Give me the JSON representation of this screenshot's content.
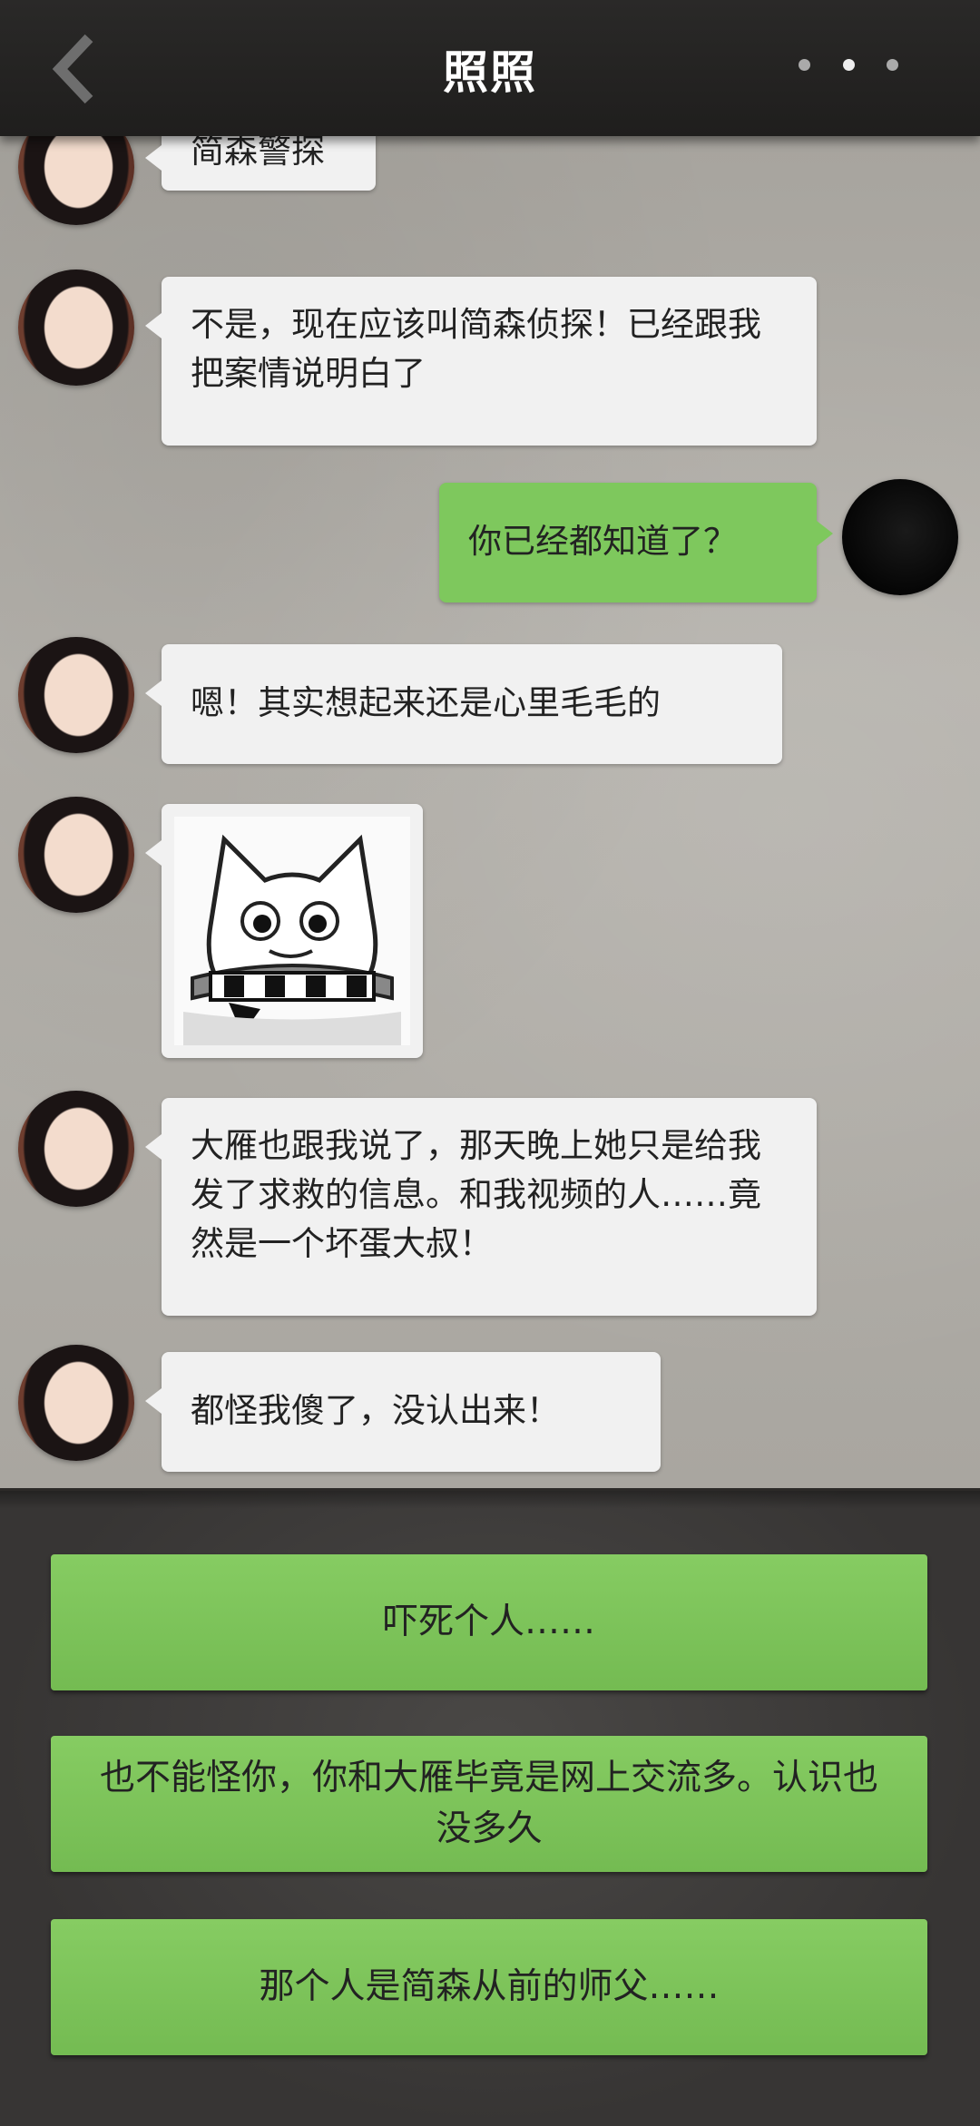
{
  "header": {
    "title": "照照"
  },
  "messages": [
    {
      "side": "in",
      "text": "简森警探"
    },
    {
      "side": "in",
      "text": "不是，现在应该叫简森侦探！已经跟我把案情说明白了"
    },
    {
      "side": "out",
      "text": "你已经都知道了？"
    },
    {
      "side": "in",
      "text": "嗯！其实想起来还是心里毛毛的"
    },
    {
      "side": "in",
      "sticker": "scared-cat-sticker"
    },
    {
      "side": "in",
      "text": "大雁也跟我说了，那天晚上她只是给我发了求救的信息。和我视频的人……竟然是一个坏蛋大叔！"
    },
    {
      "side": "in",
      "text": "都怪我傻了，没认出来！"
    }
  ],
  "options": [
    {
      "label": "吓死个人……"
    },
    {
      "label": "也不能怪你，你和大雁毕竟是网上交流多。认识也没多久"
    },
    {
      "label": "那个人是简森从前的师父……"
    }
  ]
}
